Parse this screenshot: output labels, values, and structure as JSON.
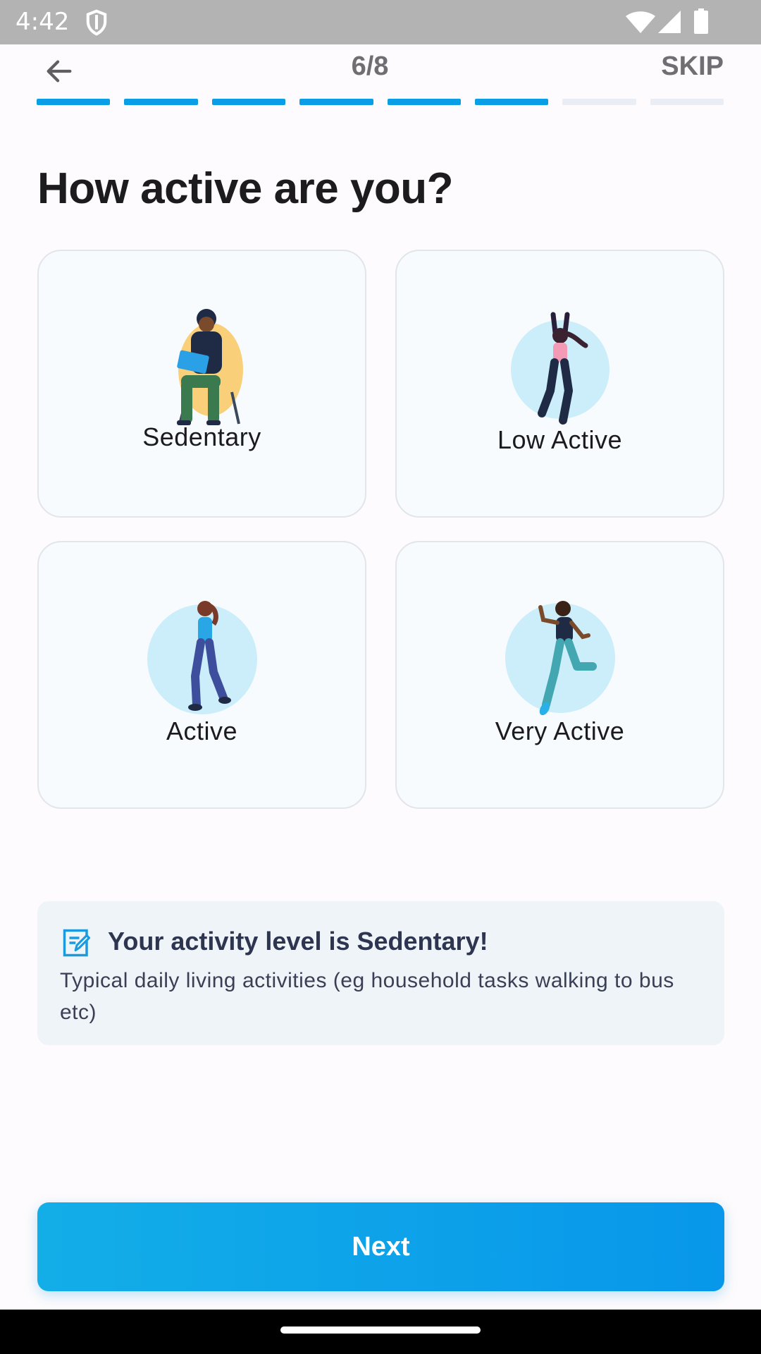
{
  "status_bar": {
    "time": "4:42",
    "icons": [
      "shield-icon",
      "wifi-icon",
      "signal-icon",
      "battery-icon"
    ]
  },
  "header": {
    "back_icon": "arrow-left-icon",
    "step": "6/8",
    "skip_label": "SKIP"
  },
  "progress": {
    "total": 8,
    "completed": 6,
    "active_color": "#0a9ee6",
    "inactive_color": "#eaedf3"
  },
  "page_title": "How active are you?",
  "options": [
    {
      "label": "Sedentary",
      "illustration": "person-sitting-laptop-illustration"
    },
    {
      "label": "Low Active",
      "illustration": "person-stretching-illustration"
    },
    {
      "label": "Active",
      "illustration": "person-walking-illustration"
    },
    {
      "label": "Very Active",
      "illustration": "person-running-illustration"
    }
  ],
  "info": {
    "icon": "edit-note-icon",
    "title": "Your activity level is Sedentary!",
    "text": "Typical daily living activities (eg household tasks walking to bus etc)"
  },
  "next_button": {
    "label": "Next",
    "color": "#0a9ee6"
  }
}
